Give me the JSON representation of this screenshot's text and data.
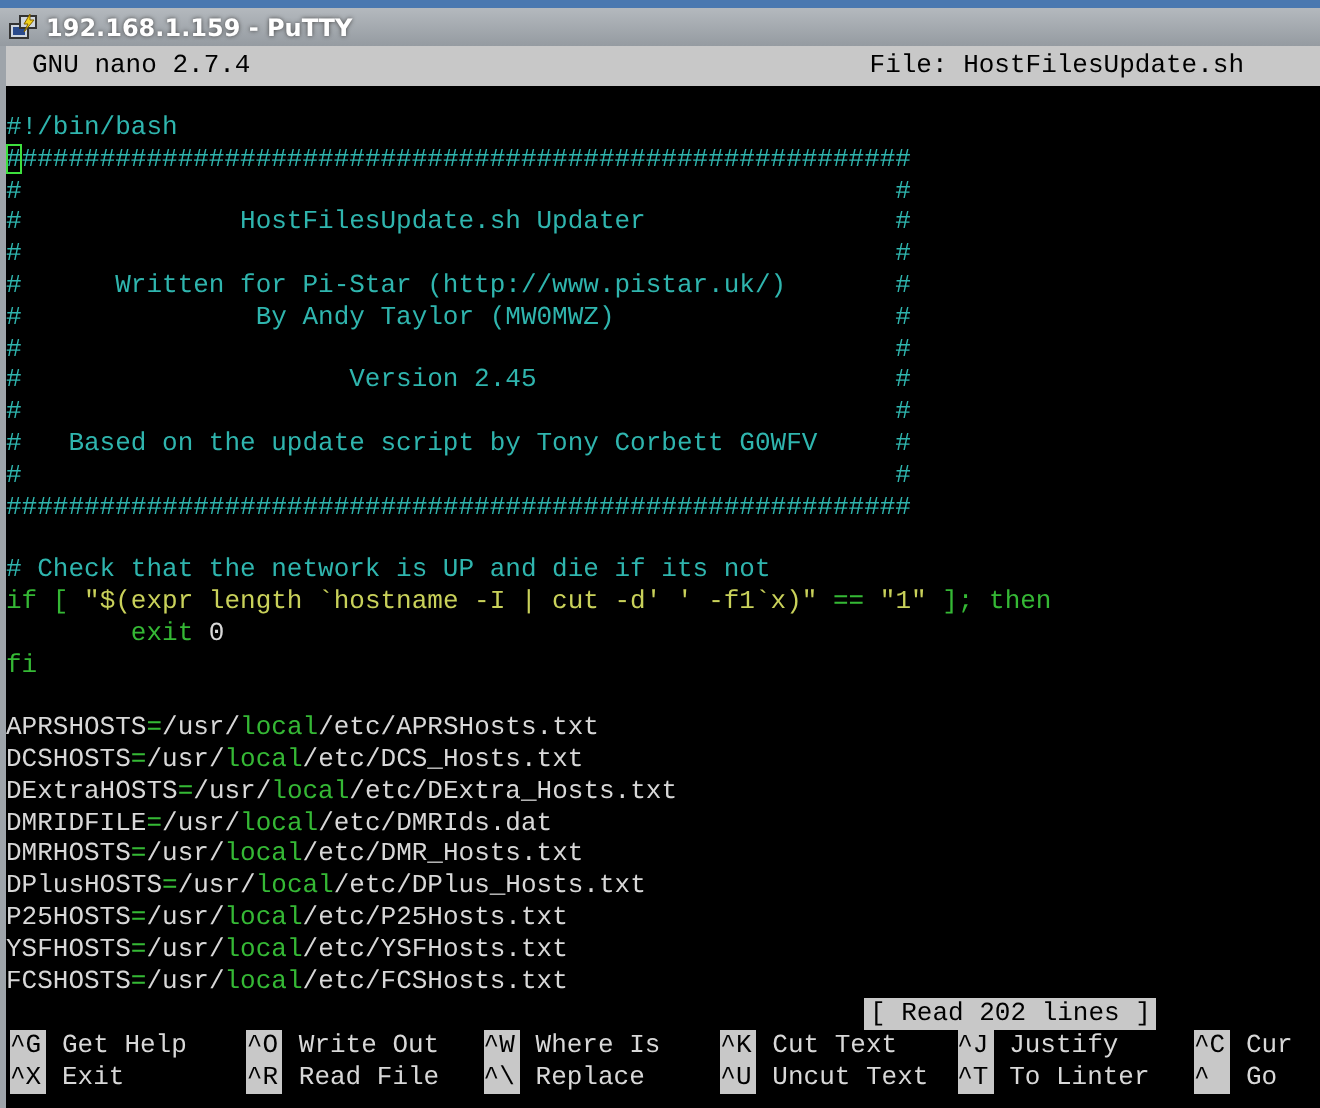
{
  "window": {
    "title": "192.168.1.159 - PuTTY"
  },
  "header": {
    "app": "GNU nano 2.7.4",
    "file": "File: HostFilesUpdate.sh"
  },
  "lines": [
    {
      "kind": "code",
      "segments": [
        {
          "kind": "comment",
          "text": "#!/bin/bash"
        }
      ]
    },
    {
      "kind": "code",
      "segments": [
        {
          "kind": "cursor",
          "text": "#"
        },
        {
          "kind": "comment",
          "text": "#########################################################"
        }
      ]
    },
    {
      "kind": "code",
      "segments": [
        {
          "kind": "comment",
          "text": "#                                                        #"
        }
      ]
    },
    {
      "kind": "code",
      "segments": [
        {
          "kind": "comment",
          "text": "#              HostFilesUpdate.sh Updater                #"
        }
      ]
    },
    {
      "kind": "code",
      "segments": [
        {
          "kind": "comment",
          "text": "#                                                        #"
        }
      ]
    },
    {
      "kind": "code",
      "segments": [
        {
          "kind": "comment",
          "text": "#      Written for Pi-Star (http://www.pistar.uk/)       #"
        }
      ]
    },
    {
      "kind": "code",
      "segments": [
        {
          "kind": "comment",
          "text": "#               By Andy Taylor (MW0MWZ)                  #"
        }
      ]
    },
    {
      "kind": "code",
      "segments": [
        {
          "kind": "comment",
          "text": "#                                                        #"
        }
      ]
    },
    {
      "kind": "code",
      "segments": [
        {
          "kind": "comment",
          "text": "#                     Version 2.45                       #"
        }
      ]
    },
    {
      "kind": "code",
      "segments": [
        {
          "kind": "comment",
          "text": "#                                                        #"
        }
      ]
    },
    {
      "kind": "code",
      "segments": [
        {
          "kind": "comment",
          "text": "#   Based on the update script by Tony Corbett G0WFV     #"
        }
      ]
    },
    {
      "kind": "code",
      "segments": [
        {
          "kind": "comment",
          "text": "#                                                        #"
        }
      ]
    },
    {
      "kind": "code",
      "segments": [
        {
          "kind": "comment",
          "text": "##########################################################"
        }
      ]
    },
    {
      "kind": "blank"
    },
    {
      "kind": "code",
      "segments": [
        {
          "kind": "comment",
          "text": "# Check that the network is UP and die if its not"
        }
      ]
    },
    {
      "kind": "code",
      "segments": [
        {
          "kind": "keyword",
          "text": "if [ "
        },
        {
          "kind": "string",
          "text": "\"$(expr length `hostname -I | cut -d' ' -f1`x)\""
        },
        {
          "kind": "keyword",
          "text": " == "
        },
        {
          "kind": "string",
          "text": "\"1\""
        },
        {
          "kind": "keyword",
          "text": " ]; then"
        }
      ]
    },
    {
      "kind": "code",
      "segments": [
        {
          "kind": "keyword",
          "text": "        exit"
        },
        {
          "kind": "plain",
          "text": " 0"
        }
      ]
    },
    {
      "kind": "code",
      "segments": [
        {
          "kind": "keyword",
          "text": "fi"
        }
      ]
    },
    {
      "kind": "blank"
    },
    {
      "kind": "code",
      "segments": [
        {
          "kind": "plain",
          "text": "APRSHOSTS"
        },
        {
          "kind": "keyword",
          "text": "="
        },
        {
          "kind": "plain",
          "text": "/usr/"
        },
        {
          "kind": "keyword",
          "text": "local"
        },
        {
          "kind": "plain",
          "text": "/etc/APRSHosts.txt"
        }
      ]
    },
    {
      "kind": "code",
      "segments": [
        {
          "kind": "plain",
          "text": "DCSHOSTS"
        },
        {
          "kind": "keyword",
          "text": "="
        },
        {
          "kind": "plain",
          "text": "/usr/"
        },
        {
          "kind": "keyword",
          "text": "local"
        },
        {
          "kind": "plain",
          "text": "/etc/DCS_Hosts.txt"
        }
      ]
    },
    {
      "kind": "code",
      "segments": [
        {
          "kind": "plain",
          "text": "DExtraHOSTS"
        },
        {
          "kind": "keyword",
          "text": "="
        },
        {
          "kind": "plain",
          "text": "/usr/"
        },
        {
          "kind": "keyword",
          "text": "local"
        },
        {
          "kind": "plain",
          "text": "/etc/DExtra_Hosts.txt"
        }
      ]
    },
    {
      "kind": "code",
      "segments": [
        {
          "kind": "plain",
          "text": "DMRIDFILE"
        },
        {
          "kind": "keyword",
          "text": "="
        },
        {
          "kind": "plain",
          "text": "/usr/"
        },
        {
          "kind": "keyword",
          "text": "local"
        },
        {
          "kind": "plain",
          "text": "/etc/DMRIds.dat"
        }
      ]
    },
    {
      "kind": "code",
      "segments": [
        {
          "kind": "plain",
          "text": "DMRHOSTS"
        },
        {
          "kind": "keyword",
          "text": "="
        },
        {
          "kind": "plain",
          "text": "/usr/"
        },
        {
          "kind": "keyword",
          "text": "local"
        },
        {
          "kind": "plain",
          "text": "/etc/DMR_Hosts.txt"
        }
      ]
    },
    {
      "kind": "code",
      "segments": [
        {
          "kind": "plain",
          "text": "DPlusHOSTS"
        },
        {
          "kind": "keyword",
          "text": "="
        },
        {
          "kind": "plain",
          "text": "/usr/"
        },
        {
          "kind": "keyword",
          "text": "local"
        },
        {
          "kind": "plain",
          "text": "/etc/DPlus_Hosts.txt"
        }
      ]
    },
    {
      "kind": "code",
      "segments": [
        {
          "kind": "plain",
          "text": "P25HOSTS"
        },
        {
          "kind": "keyword",
          "text": "="
        },
        {
          "kind": "plain",
          "text": "/usr/"
        },
        {
          "kind": "keyword",
          "text": "local"
        },
        {
          "kind": "plain",
          "text": "/etc/P25Hosts.txt"
        }
      ]
    },
    {
      "kind": "code",
      "segments": [
        {
          "kind": "plain",
          "text": "YSFHOSTS"
        },
        {
          "kind": "keyword",
          "text": "="
        },
        {
          "kind": "plain",
          "text": "/usr/"
        },
        {
          "kind": "keyword",
          "text": "local"
        },
        {
          "kind": "plain",
          "text": "/etc/YSFHosts.txt"
        }
      ]
    },
    {
      "kind": "code",
      "segments": [
        {
          "kind": "plain",
          "text": "FCSHOSTS"
        },
        {
          "kind": "keyword",
          "text": "="
        },
        {
          "kind": "plain",
          "text": "/usr/"
        },
        {
          "kind": "keyword",
          "text": "local"
        },
        {
          "kind": "plain",
          "text": "/etc/FCSHosts.txt"
        }
      ]
    }
  ],
  "status": "[ Read 202 lines ]",
  "shortcuts": [
    [
      {
        "key": "^G",
        "label": "Get Help"
      },
      {
        "key": "^O",
        "label": "Write Out"
      },
      {
        "key": "^W",
        "label": "Where Is"
      },
      {
        "key": "^K",
        "label": "Cut Text"
      },
      {
        "key": "^J",
        "label": "Justify"
      },
      {
        "key": "^C",
        "label": "Cur"
      }
    ],
    [
      {
        "key": "^X",
        "label": "Exit"
      },
      {
        "key": "^R",
        "label": "Read File"
      },
      {
        "key": "^\\",
        "label": "Replace"
      },
      {
        "key": "^U",
        "label": "Uncut Text"
      },
      {
        "key": "^T",
        "label": "To Linter"
      },
      {
        "key": "^",
        "label": "Go"
      }
    ]
  ]
}
